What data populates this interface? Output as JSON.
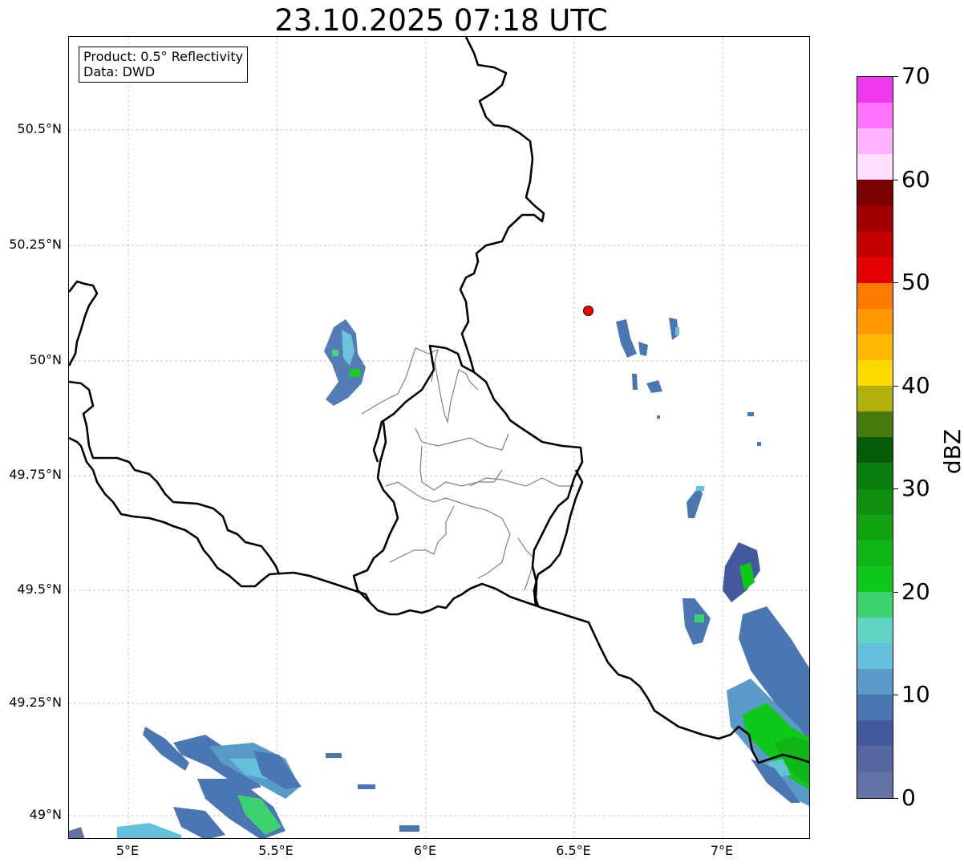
{
  "title": "23.10.2025 07:18 UTC",
  "info_box": {
    "product": "Product: 0.5° Reflectivity",
    "data_source": "Data: DWD"
  },
  "lat_labels": [
    "50.5°N",
    "50.25°N",
    "50°N",
    "49.75°N",
    "49.5°N",
    "49.25°N",
    "49°N"
  ],
  "lon_labels": [
    "5°E",
    "5.5°E",
    "6°E",
    "6.5°E",
    "7°E"
  ],
  "colorbar": {
    "unit": "dBZ",
    "tick_labels": [
      "0",
      "10",
      "20",
      "30",
      "40",
      "50",
      "60",
      "70"
    ],
    "colors": [
      "#6373a6",
      "#56689f",
      "#44599d",
      "#4b76b4",
      "#5a9ac8",
      "#65c0dc",
      "#5fd6c3",
      "#3cd36f",
      "#10c81a",
      "#0fb716",
      "#11a412",
      "#0e8f10",
      "#0b7c0e",
      "#055d07",
      "#487b0c",
      "#b0b00a",
      "#ffd800",
      "#ffb800",
      "#ff9800",
      "#ff7800",
      "#e60000",
      "#c40000",
      "#a00000",
      "#7a0000",
      "#ffddff",
      "#ffb3ff",
      "#ff70ff",
      "#ee38ee"
    ]
  },
  "radar_site_color": "#ff0000"
}
